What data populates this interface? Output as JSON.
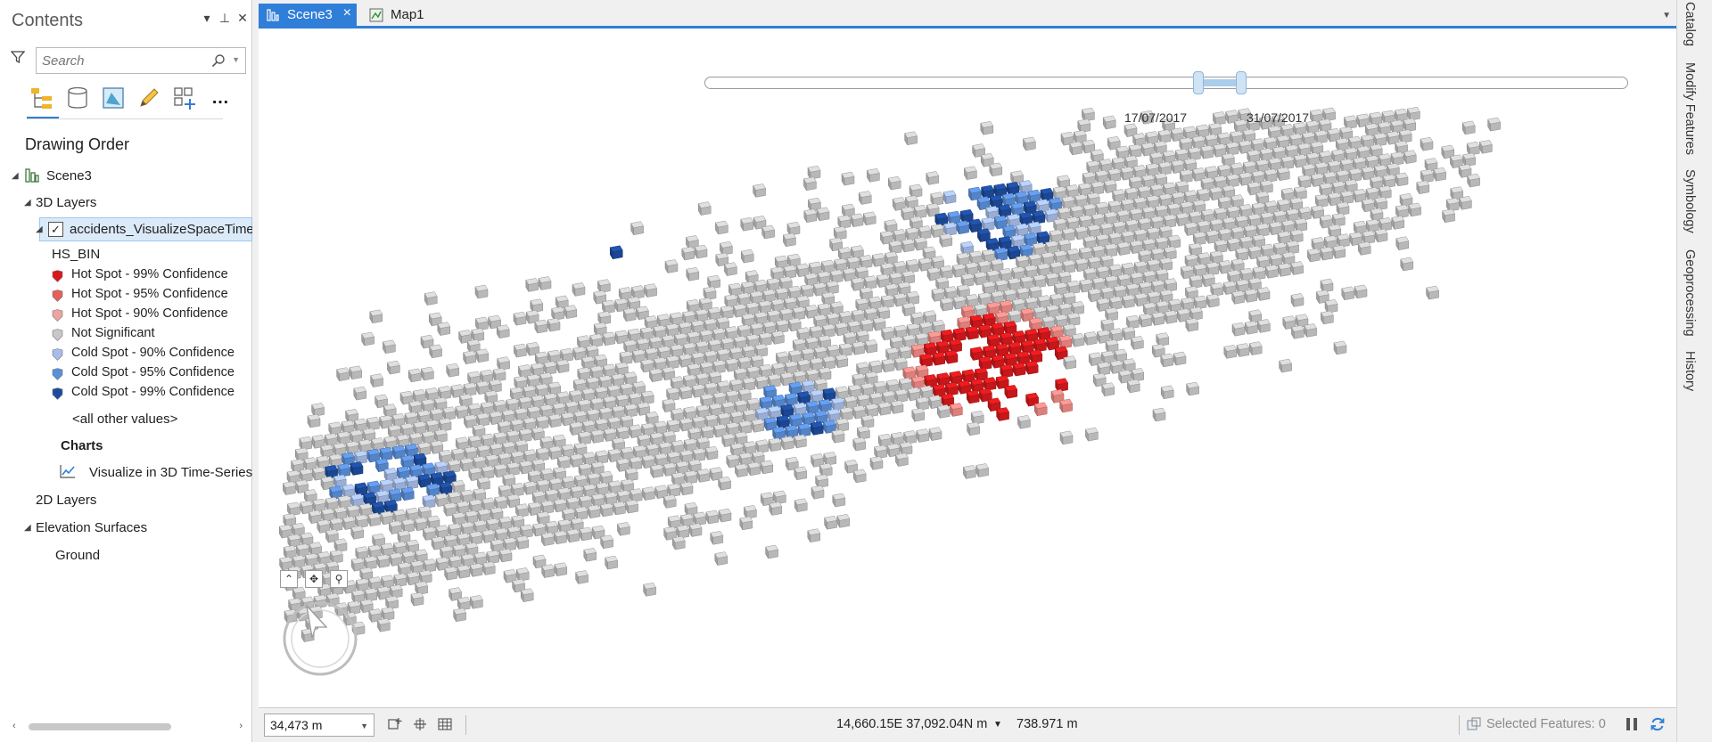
{
  "contents": {
    "title": "Contents",
    "controls": {
      "menu": "▾",
      "pin": "⊥",
      "close": "✕"
    },
    "search": {
      "placeholder": "Search"
    },
    "tools": [
      "list-by-drawing-order-icon",
      "list-by-source-icon",
      "list-by-selection-icon",
      "list-by-editing-icon",
      "list-by-snapping-icon",
      "more-icon"
    ],
    "more_label": "…",
    "drawing_order_label": "Drawing Order",
    "tree": {
      "scene": "Scene3",
      "layers_3d": "3D Layers",
      "layer_name": "accidents_VisualizeSpaceTime(",
      "field": "HS_BIN",
      "legend": [
        {
          "label": "Hot Spot - 99% Confidence",
          "color": "#d7191c"
        },
        {
          "label": "Hot Spot - 95% Confidence",
          "color": "#e4605a"
        },
        {
          "label": "Hot Spot - 90% Confidence",
          "color": "#eea3a0"
        },
        {
          "label": "Not Significant",
          "color": "#c8c8c8"
        },
        {
          "label": "Cold Spot - 90% Confidence",
          "color": "#a7bde8"
        },
        {
          "label": "Cold Spot - 95% Confidence",
          "color": "#5b8fd9"
        },
        {
          "label": "Cold Spot - 99% Confidence",
          "color": "#1d4c9e"
        }
      ],
      "other_values": "<all other values>",
      "charts_header": "Charts",
      "chart_item": "Visualize in 3D Time-Series",
      "layers_2d": "2D Layers",
      "elevation": "Elevation Surfaces",
      "ground": "Ground"
    }
  },
  "view_tabs": [
    {
      "label": "Scene3",
      "active": true
    },
    {
      "label": "Map1",
      "active": false
    }
  ],
  "time_slider": {
    "start_date": "17/07/2017",
    "end_date": "31/07/2017"
  },
  "statusbar": {
    "scale": "34,473 m",
    "coordinates": "14,660.15E 37,092.04N m",
    "elevation": "738.971 m",
    "selected_features": "Selected Features: 0"
  },
  "right_dock": [
    "Catalog",
    "Modify Features",
    "Symbology",
    "Geoprocessing",
    "History"
  ],
  "colors": {
    "accent": "#2f7ed8",
    "not_significant": "#c8c8c8",
    "hot_99": "#d7191c",
    "cold_90": "#a7bde8",
    "cold_95": "#5b8fd9",
    "cold_99": "#1d4c9e"
  }
}
